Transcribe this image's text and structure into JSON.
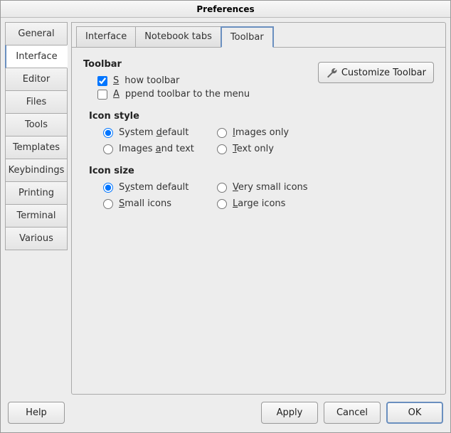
{
  "window": {
    "title": "Preferences"
  },
  "sidetabs": [
    {
      "label": "General",
      "active": false
    },
    {
      "label": "Interface",
      "active": true
    },
    {
      "label": "Editor",
      "active": false
    },
    {
      "label": "Files",
      "active": false
    },
    {
      "label": "Tools",
      "active": false
    },
    {
      "label": "Templates",
      "active": false
    },
    {
      "label": "Keybindings",
      "active": false
    },
    {
      "label": "Printing",
      "active": false
    },
    {
      "label": "Terminal",
      "active": false
    },
    {
      "label": "Various",
      "active": false
    }
  ],
  "toptabs": [
    {
      "label": "Interface",
      "active": false
    },
    {
      "label": "Notebook tabs",
      "active": false
    },
    {
      "label": "Toolbar",
      "active": true
    }
  ],
  "toolbar": {
    "section_label": "Toolbar",
    "show_label": "Show toolbar",
    "show_label_prefix": "S",
    "show_label_rest": "how toolbar",
    "show_checked": true,
    "append_label_prefix": "A",
    "append_label_rest": "ppend toolbar to the menu",
    "append_checked": false,
    "customize_label": "Customize Toolbar"
  },
  "icon_style": {
    "label": "Icon style",
    "options": [
      {
        "label": "System default",
        "underline_pre": "System ",
        "underline_char": "d",
        "underline_post": "efault",
        "checked": true
      },
      {
        "label": "Images only",
        "underline_pre": "",
        "underline_char": "I",
        "underline_post": "mages only",
        "checked": false
      },
      {
        "label": "Images and text",
        "underline_pre": "Images ",
        "underline_char": "a",
        "underline_post": "nd text",
        "checked": false
      },
      {
        "label": "Text only",
        "underline_pre": "",
        "underline_char": "T",
        "underline_post": "ext only",
        "checked": false
      }
    ]
  },
  "icon_size": {
    "label": "Icon size",
    "options": [
      {
        "label": "System default",
        "underline_pre": "S",
        "underline_char": "y",
        "underline_post": "stem default",
        "checked": true
      },
      {
        "label": "Very small icons",
        "underline_pre": "",
        "underline_char": "V",
        "underline_post": "ery small icons",
        "checked": false
      },
      {
        "label": "Small icons",
        "underline_pre": "",
        "underline_char": "S",
        "underline_post": "mall icons",
        "checked": false
      },
      {
        "label": "Large icons",
        "underline_pre": "",
        "underline_char": "L",
        "underline_post": "arge icons",
        "checked": false
      }
    ]
  },
  "footer": {
    "help": "Help",
    "apply": "Apply",
    "cancel": "Cancel",
    "ok": "OK"
  }
}
